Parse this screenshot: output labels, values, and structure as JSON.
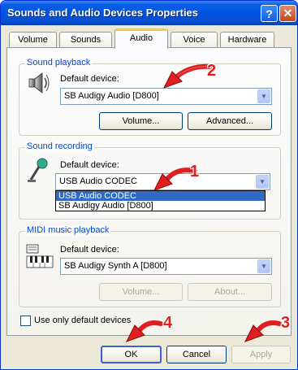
{
  "window": {
    "title": "Sounds and Audio Devices Properties"
  },
  "titlebar": {
    "help_glyph": "?",
    "close_glyph": "✕"
  },
  "tabs": [
    {
      "label": "Volume"
    },
    {
      "label": "Sounds"
    },
    {
      "label": "Audio"
    },
    {
      "label": "Voice"
    },
    {
      "label": "Hardware"
    }
  ],
  "playback": {
    "group_label": "Sound playback",
    "default_label": "Default device:",
    "device": "SB Audigy Audio [D800]",
    "volume_button": "Volume...",
    "advanced_button": "Advanced..."
  },
  "recording": {
    "group_label": "Sound recording",
    "default_label": "Default device:",
    "device": "USB Audio CODEC",
    "options": [
      "USB Audio CODEC",
      "SB Audigy Audio [D800]"
    ]
  },
  "midi": {
    "group_label": "MIDI music playback",
    "default_label": "Default device:",
    "device": "SB Audigy Synth A [D800]",
    "volume_button": "Volume...",
    "about_button": "About..."
  },
  "checkbox": {
    "label": "Use only default devices"
  },
  "footer": {
    "ok": "OK",
    "cancel": "Cancel",
    "apply": "Apply"
  },
  "annotations": [
    "1",
    "2",
    "3",
    "4"
  ],
  "colors": {
    "title_bar": "#0054e3",
    "group_label": "#0046d5",
    "annotation": "#e02020",
    "selection": "#316ac5"
  }
}
